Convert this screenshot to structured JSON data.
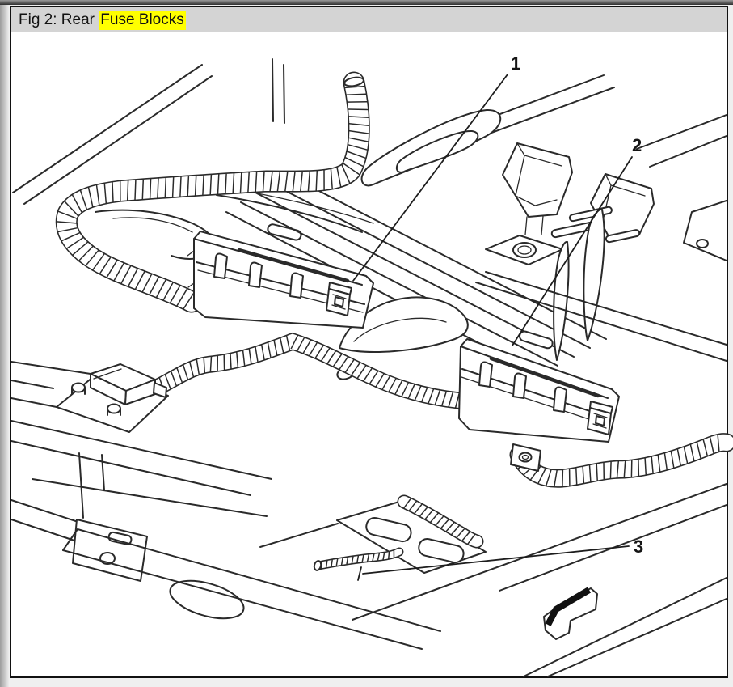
{
  "window": {
    "background": "#efefef",
    "titlebar_bg": "#d4d4d4",
    "border_color": "#111111"
  },
  "figure": {
    "caption_prefix": "Fig 2: Rear ",
    "caption_highlight": "Fuse Blocks",
    "highlight_color": "#ffff00",
    "callouts": [
      {
        "label": "1"
      },
      {
        "label": "2"
      },
      {
        "label": "3"
      }
    ],
    "arrow_icon": "3d-arrow-southwest"
  },
  "drawing": {
    "line_color": "#2a2a2a",
    "paper_color": "#ffffff"
  }
}
